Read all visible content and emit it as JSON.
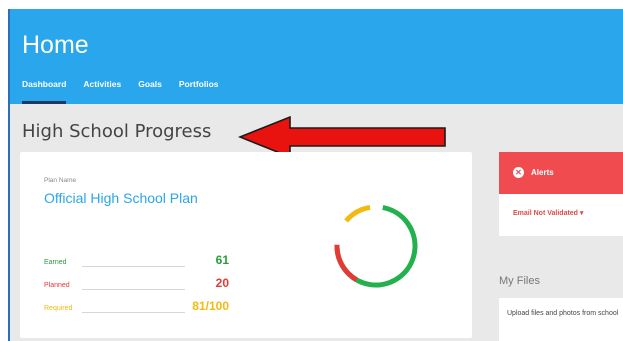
{
  "header": {
    "title": "Home",
    "tabs": [
      {
        "label": "Dashboard",
        "active": true
      },
      {
        "label": "Activities",
        "active": false
      },
      {
        "label": "Goals",
        "active": false
      },
      {
        "label": "Portfolios",
        "active": false
      }
    ]
  },
  "main": {
    "section_title": "High School Progress",
    "plan_card": {
      "plan_name_label": "Plan Name",
      "plan_name": "Official High School Plan",
      "stats": {
        "earned": {
          "label": "Earned",
          "value": "61",
          "color": "#2a9d3a"
        },
        "planned": {
          "label": "Planned",
          "value": "20",
          "color": "#e53935"
        },
        "required": {
          "label": "Required",
          "value": "81/100",
          "color": "#f2b90f"
        }
      }
    },
    "annotation": {
      "arrow_color": "#e8130f",
      "icon": "left-arrow-icon"
    }
  },
  "sidebar": {
    "alerts": {
      "title": "Alerts",
      "icon": "close-circle-icon",
      "item": "Email Not Validated ▾",
      "color": "#f04b4e"
    },
    "files": {
      "title": "My Files",
      "description": "Upload files and photos from school"
    }
  },
  "colors": {
    "header": "#2aa6ec",
    "link": "#2aa6ec",
    "ring_green": "#22b14c",
    "ring_yellow": "#f2b90f",
    "ring_red": "#e53935"
  }
}
